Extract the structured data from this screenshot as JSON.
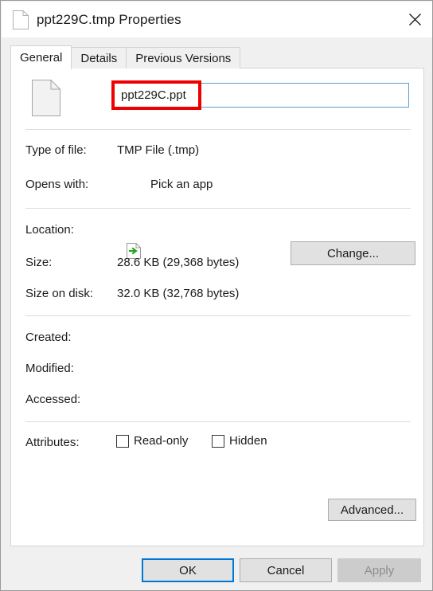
{
  "window": {
    "title": "ppt229C.tmp Properties",
    "title_icon": "file-document-icon",
    "close_icon": "close-icon"
  },
  "tabs": [
    {
      "label": "General",
      "active": true
    },
    {
      "label": "Details",
      "active": false
    },
    {
      "label": "Previous Versions",
      "active": false
    }
  ],
  "general": {
    "file_icon": "generic-file-icon",
    "filename": {
      "value": "ppt229C.ppt",
      "placeholder": "",
      "highlight_color": "#ef0000"
    },
    "type_of_file": {
      "label": "Type of file:",
      "value": "TMP File (.tmp)"
    },
    "opens_with": {
      "label": "Opens with:",
      "value": "Pick an app",
      "icon": "pick-an-app-icon",
      "button": "Change..."
    },
    "location": {
      "label": "Location:",
      "value": ""
    },
    "size": {
      "label": "Size:",
      "value": "28.6 KB (29,368 bytes)"
    },
    "size_on_disk": {
      "label": "Size on disk:",
      "value": "32.0 KB (32,768 bytes)"
    },
    "created": {
      "label": "Created:",
      "value": ""
    },
    "modified": {
      "label": "Modified:",
      "value": ""
    },
    "accessed": {
      "label": "Accessed:",
      "value": ""
    },
    "attributes": {
      "label": "Attributes:",
      "read_only": {
        "label": "Read-only",
        "checked": false
      },
      "hidden": {
        "label": "Hidden",
        "checked": false
      },
      "advanced_button": "Advanced..."
    }
  },
  "footer": {
    "ok": "OK",
    "cancel": "Cancel",
    "apply": "Apply",
    "apply_disabled": true,
    "focus_color": "#0078d7"
  }
}
